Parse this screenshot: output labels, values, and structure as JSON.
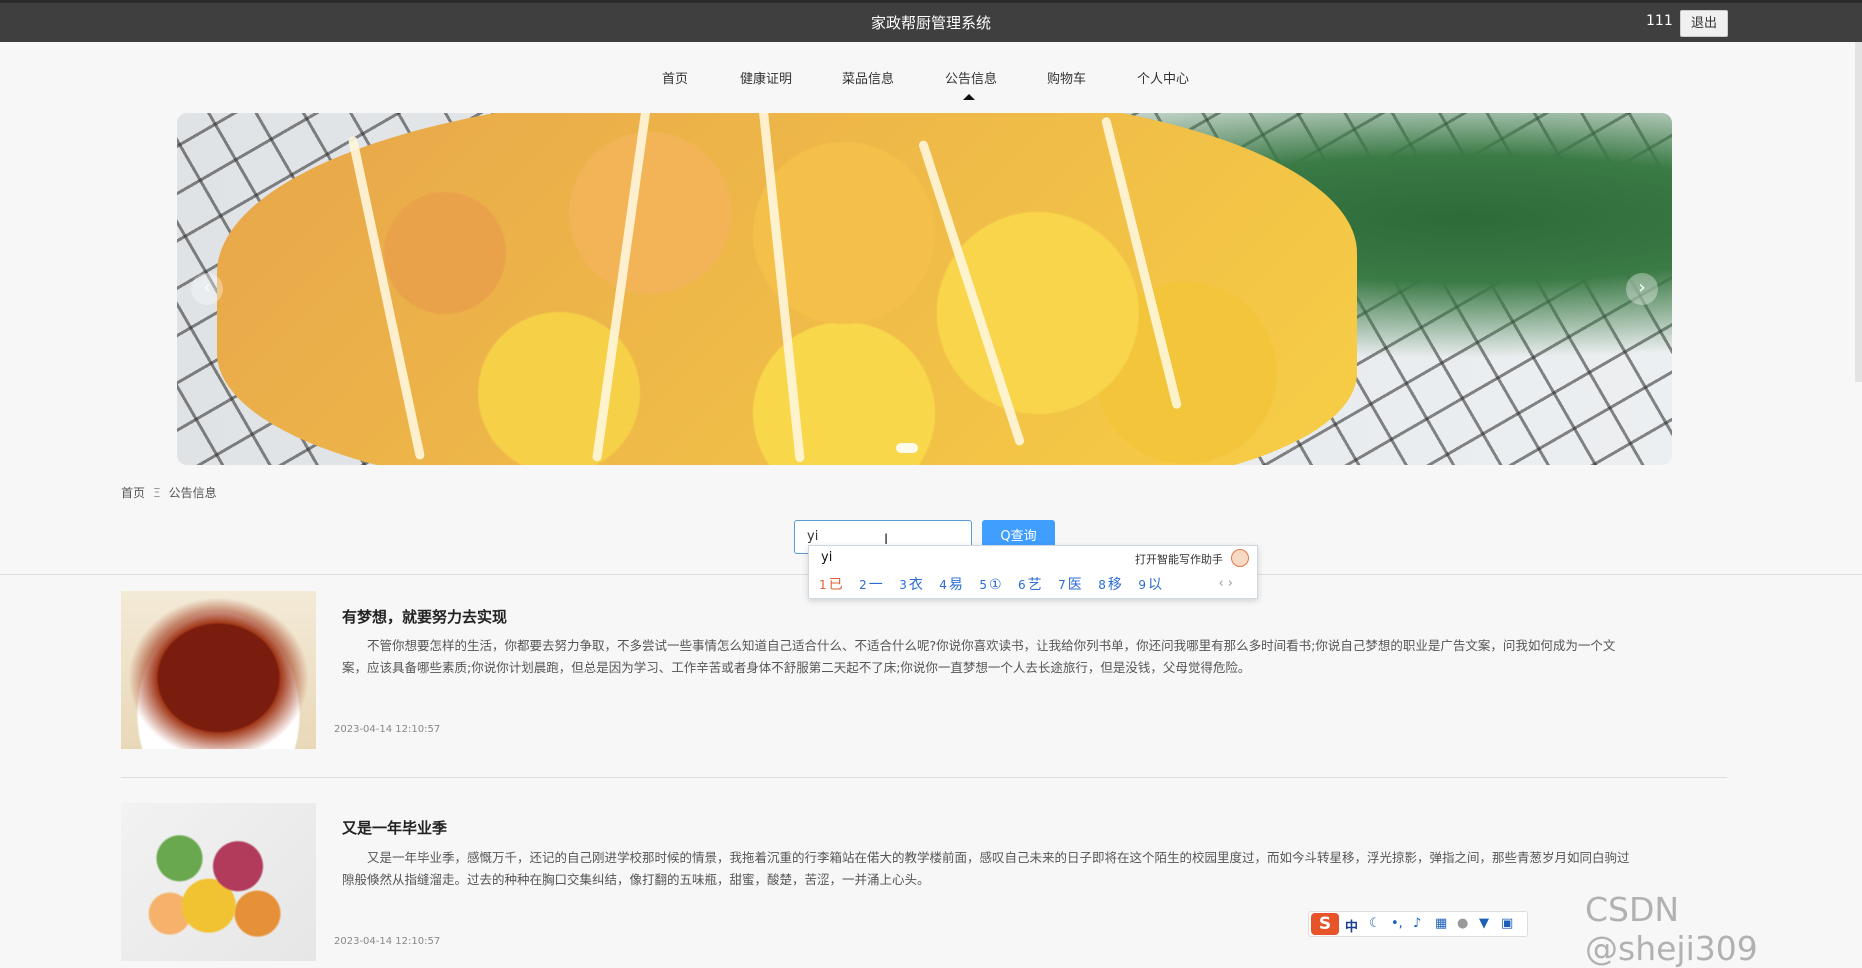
{
  "app": {
    "title": "家政帮厨管理系统",
    "user": "111",
    "logout_label": "退出"
  },
  "nav": {
    "items": [
      {
        "label": "首页"
      },
      {
        "label": "健康证明"
      },
      {
        "label": "菜品信息"
      },
      {
        "label": "公告信息"
      },
      {
        "label": "购物车"
      },
      {
        "label": "个人中心"
      }
    ],
    "active": "公告信息"
  },
  "banner": {
    "prev_icon": "‹",
    "next_icon": "›"
  },
  "breadcrumb": {
    "home": "首页",
    "separator": "Ξ",
    "current": "公告信息"
  },
  "search": {
    "value": "yi",
    "button_label": "Q查询"
  },
  "ime": {
    "pinyin": "yi",
    "assistant": "打开智能写作助手",
    "candidates": [
      {
        "n": "1",
        "c": "已"
      },
      {
        "n": "2",
        "c": "一"
      },
      {
        "n": "3",
        "c": "衣"
      },
      {
        "n": "4",
        "c": "易"
      },
      {
        "n": "5",
        "c": "①"
      },
      {
        "n": "6",
        "c": "艺"
      },
      {
        "n": "7",
        "c": "医"
      },
      {
        "n": "8",
        "c": "移"
      },
      {
        "n": "9",
        "c": "以"
      }
    ],
    "pager": "‹ ›"
  },
  "notices": [
    {
      "title": "有梦想，就要努力去实现",
      "body": "不管你想要怎样的生活，你都要去努力争取，不多尝试一些事情怎么知道自己适合什么、不适合什么呢?你说你喜欢读书，让我给你列书单，你还问我哪里有那么多时间看书;你说自己梦想的职业是广告文案，问我如何成为一个文案，应该具备哪些素质;你说你计划晨跑，但总是因为学习、工作辛苦或者身体不舒服第二天起不了床;你说你一直梦想一个人去长途旅行，但是没钱，父母觉得危险。",
      "time": "2023-04-14 12:10:57"
    },
    {
      "title": "又是一年毕业季",
      "body": "又是一年毕业季，感慨万千，还记的自己刚进学校那时候的情景，我拖着沉重的行李箱站在偌大的教学楼前面，感叹自己未来的日子即将在这个陌生的校园里度过，而如今斗转星移，浮光掠影，弹指之间，那些青葱岁月如同白驹过隙般倏然从指缝溜走。过去的种种在胸口交集纠结，像打翻的五味瓶，甜蜜，酸楚，苦涩，一并涌上心头。",
      "time": "2023-04-14 12:10:57"
    }
  ],
  "tray": {
    "logo": "S",
    "lang": "中"
  },
  "watermark": "CSDN @sheji309"
}
